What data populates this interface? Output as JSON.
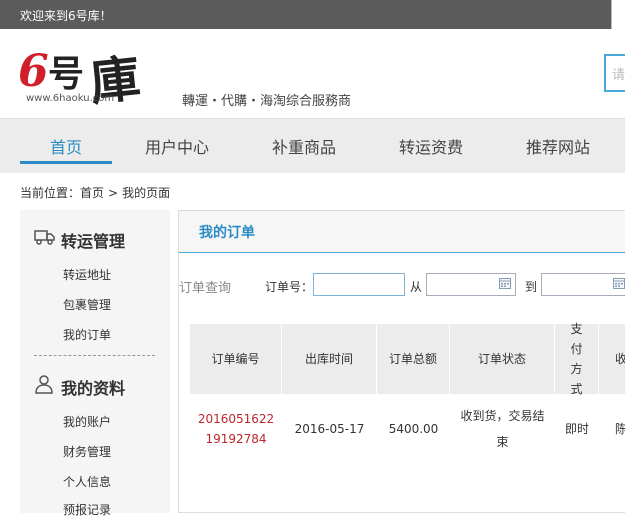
{
  "topbar": {
    "welcome": "欢迎来到6号库！"
  },
  "logo": {
    "url_text": "www.6haoku.com",
    "alt_name": "6号库"
  },
  "slogan": "轉運・代購・海淘综合服務商",
  "search": {
    "placeholder": "请"
  },
  "nav": {
    "items": [
      {
        "label": "首页",
        "active": true
      },
      {
        "label": "用户中心"
      },
      {
        "label": "补重商品"
      },
      {
        "label": "转运资费"
      },
      {
        "label": "推荐网站"
      }
    ]
  },
  "breadcrumb": {
    "prefix": "当前位置：",
    "home": "首页",
    "sep": ">",
    "current": "我的页面"
  },
  "sidebar": {
    "section1": {
      "title": "转运管理",
      "icon": "truck-icon",
      "items": [
        "转运地址",
        "包裹管理",
        "我的订单"
      ]
    },
    "section2": {
      "title": "我的资料",
      "icon": "user-icon",
      "items": [
        "我的账户",
        "财务管理",
        "个人信息",
        "预报记录"
      ]
    }
  },
  "main": {
    "title": "我的订单",
    "query": {
      "label": "订单查询",
      "order_label": "订单号：",
      "from_label": "从",
      "to_label": "到",
      "order_value": "",
      "from_value": "",
      "to_value": ""
    },
    "table": {
      "headers": [
        "订单编号",
        "出库时间",
        "订单总额",
        "订单状态",
        "支付方式",
        "收"
      ],
      "rows": [
        {
          "order_no_1": "2016051622",
          "order_no_2": "19192784",
          "date": "2016-05-17",
          "amount": "5400.00",
          "status_1": "收到货，交易结",
          "status_2": "束",
          "payment": "即时",
          "extra": "陈"
        }
      ]
    }
  },
  "colors": {
    "accent": "#2b8cc4",
    "order_link": "#c0262c",
    "topbar": "#5b5b5b"
  }
}
